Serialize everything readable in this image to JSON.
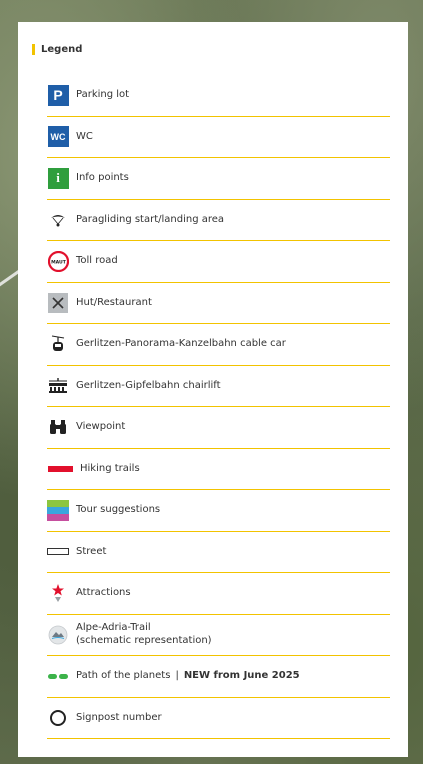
{
  "legend": {
    "title": "Legend",
    "items": [
      {
        "symbol": "parking-sign",
        "label": "Parking lot",
        "sign_text": "P",
        "color": "#1f5ea8"
      },
      {
        "symbol": "wc-sign",
        "label": "WC",
        "sign_text": "WC",
        "color": "#1f5ea8"
      },
      {
        "symbol": "info-sign",
        "label": "Info points",
        "sign_text": "i",
        "color": "#2f9e3d"
      },
      {
        "symbol": "paraglider-icon",
        "label": "Paragliding start/landing area"
      },
      {
        "symbol": "toll-road-sign",
        "label": "Toll road",
        "sign_text": "MAUT"
      },
      {
        "symbol": "hut-restaurant-icon",
        "label": "Hut/Restaurant"
      },
      {
        "symbol": "cable-car-icon",
        "label": "Gerlitzen-Panorama-Kanzelbahn cable car"
      },
      {
        "symbol": "chairlift-icon",
        "label": "Gerlitzen-Gipfelbahn chairlift"
      },
      {
        "symbol": "binoculars-icon",
        "label": "Viewpoint"
      },
      {
        "symbol": "hiking-trail-line",
        "label": "Hiking trails",
        "color": "#e2102c"
      },
      {
        "symbol": "tour-suggestion-lines",
        "label": "Tour suggestions",
        "colors": [
          "#8cc63f",
          "#3aa6dd",
          "#c64f9f"
        ]
      },
      {
        "symbol": "street-line",
        "label": "Street"
      },
      {
        "symbol": "attraction-star-icon",
        "label": "Attractions",
        "color": "#e2102c"
      },
      {
        "symbol": "alpe-adria-trail-icon",
        "label": "Alpe-Adria-Trail",
        "sub_label": "(schematic representation)"
      },
      {
        "symbol": "planets-path-line",
        "label": "Path of the planets",
        "separator": "|",
        "highlight": "NEW from June 2025",
        "color": "#3cb34a"
      },
      {
        "symbol": "signpost-circle",
        "label": "Signpost number"
      }
    ]
  },
  "accent_color": "#f2c300"
}
